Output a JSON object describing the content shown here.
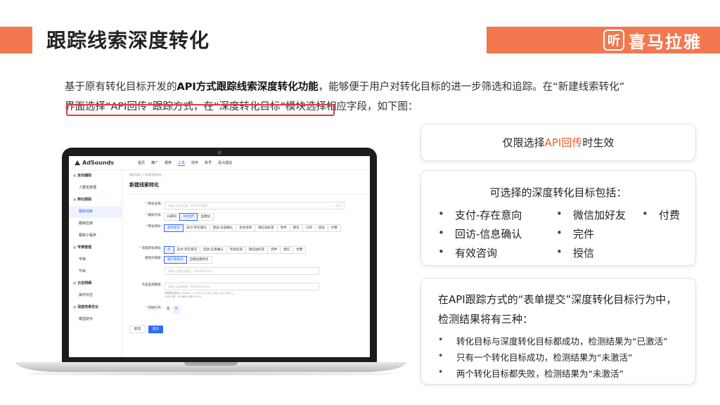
{
  "header": {
    "title": "跟踪线索深度转化",
    "brand_logo": "听",
    "brand_name": "喜马拉雅"
  },
  "intro": {
    "p1_a": "基于原有转化目标开发的",
    "p1_bold": "API方式跟踪线索深度转化功能",
    "p1_b": "，能够便于用户对转化目标的进一步筛选和追踪。在“新建线索转化”",
    "p2": "界面选择“API回传”跟踪方式，在“深度转化目标”模块选择相应字段，如下图："
  },
  "app": {
    "logo": "AdSounds",
    "nav": [
      "首页",
      "推广",
      "报表",
      "工具",
      "财务",
      "账号",
      "喜马建站"
    ],
    "nav_active": "工具",
    "sidebar": [
      {
        "label": "定向辅助",
        "group": true
      },
      {
        "label": "人群包管理",
        "group": false
      },
      {
        "label": "转化跟踪",
        "group": true
      },
      {
        "label": "跟踪线索",
        "group": false,
        "active": true
      },
      {
        "label": "跟踪应用",
        "group": false
      },
      {
        "label": "跟踪小程序",
        "group": false
      },
      {
        "label": "专辑管理",
        "group": true
      },
      {
        "label": "专辑",
        "group": false
      },
      {
        "label": "节目",
        "group": false
      },
      {
        "label": "日志明细",
        "group": true
      },
      {
        "label": "操作日志",
        "group": false
      },
      {
        "label": "深度效果优化",
        "group": true
      },
      {
        "label": "模型助手",
        "group": false
      }
    ],
    "breadcrumb": "跟踪线索 > 新建线索转化",
    "page_title": "新建线索转化",
    "form": {
      "name_label": "转化名称:",
      "name_placeholder": "请输入转化名称，名称不可重复",
      "name_count": "0/25",
      "method_label": "跟踪方式:",
      "methods": [
        "JS部码",
        "API回传",
        "自建站"
      ],
      "method_active": "API回传",
      "target_label": "转化目标:",
      "targets": [
        "表单提交",
        "支付-存在意向",
        "回访-信息确认",
        "有效咨询",
        "微信加好友",
        "完件",
        "授信",
        "订阅",
        "回访",
        "付费"
      ],
      "target_active": "表单提交",
      "deep_label": "深度转化目标:",
      "deep_targets": [
        "无",
        "支付-存在意向",
        "回访-信息确认",
        "有效咨询",
        "微信加好友",
        "完件",
        "授信",
        "付费"
      ],
      "deep_active": "无",
      "landing_label": "落地页链接:",
      "landing_tabs": [
        "填写落地页",
        "自建站落地页"
      ],
      "landing_placeholder": "请输入落地页链接，http/https开头",
      "click_label": "点击监测链接:",
      "click_placeholder": "请输入监测链接，http/https开头",
      "click_note1": "请替换宏参数 callback_{_CLICK_ID_}&{_MAC_}&{_IDFA_}",
      "click_note2": "{IMEI}等，URL最大长度为1024",
      "inner_label": "内链打开:",
      "inner_options": [
        "是",
        "否"
      ],
      "inner_active": "否",
      "cancel": "取消",
      "submit": "提交"
    }
  },
  "card1": {
    "a": "仅限选择",
    "hl": "API回传",
    "b": "时生效"
  },
  "card2": {
    "title": "可选择的深度转化目标包括：",
    "options": [
      "支付-存在意向",
      "微信加好友",
      "付费",
      "回访-信息确认",
      "完件",
      "有效咨询",
      "授信"
    ]
  },
  "card3": {
    "title": "在API跟踪方式的“表单提交”深度转化目标行为中，检测结果将有三种：",
    "results": [
      "转化目标与深度转化目标都成功，检测结果为“已激活”",
      "只有一个转化目标成功，检测结果为“未激活”",
      "两个转化目标都失败，检测结果为“未激活”"
    ]
  },
  "colors": {
    "accent": "#f3774f",
    "highlight": "#f05a28",
    "app_primary": "#2f6bff",
    "red_box": "#e2393b"
  }
}
